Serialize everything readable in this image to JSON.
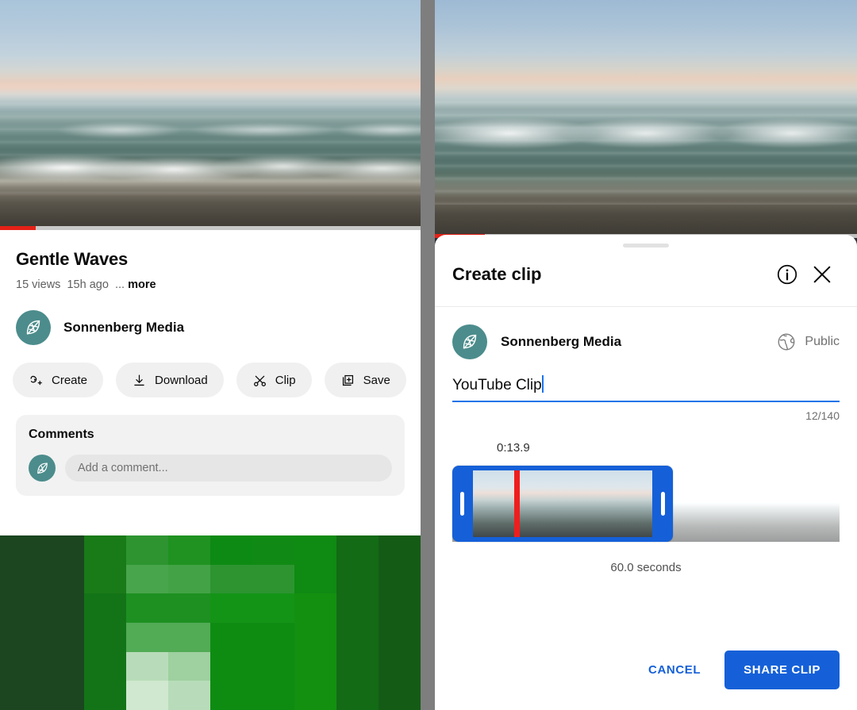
{
  "left": {
    "video": {
      "progress_color": "#e62117"
    },
    "title": "Gentle Waves",
    "views": "15 views",
    "age": "15h ago",
    "ellipsis": "...",
    "more_label": "more",
    "channel_name": "Sonnenberg Media",
    "chips": [
      {
        "label": "Create",
        "icon": "create-icon"
      },
      {
        "label": "Download",
        "icon": "download-icon"
      },
      {
        "label": "Clip",
        "icon": "scissors-icon"
      },
      {
        "label": "Save",
        "icon": "save-icon"
      }
    ],
    "comments": {
      "heading": "Comments",
      "placeholder": "Add a comment..."
    }
  },
  "right": {
    "sheet_title": "Create clip",
    "info_icon": "info-circle-icon",
    "close_icon": "close-icon",
    "channel_name": "Sonnenberg Media",
    "privacy_label": "Public",
    "privacy_icon": "globe-icon",
    "clip_title_value": "YouTube Clip",
    "char_counter": "12/140",
    "start_timestamp": "0:13.9",
    "duration_label": "60.0 seconds",
    "cancel_label": "CANCEL",
    "share_label": "SHARE CLIP",
    "accent_color": "#1560d8",
    "playhead_color": "#f01d1d"
  },
  "colors": {
    "brand_red": "#e62117",
    "avatar_teal": "#4c8c8c",
    "accent_blue": "#1560d8",
    "chip_gray": "#f0f0f0"
  }
}
